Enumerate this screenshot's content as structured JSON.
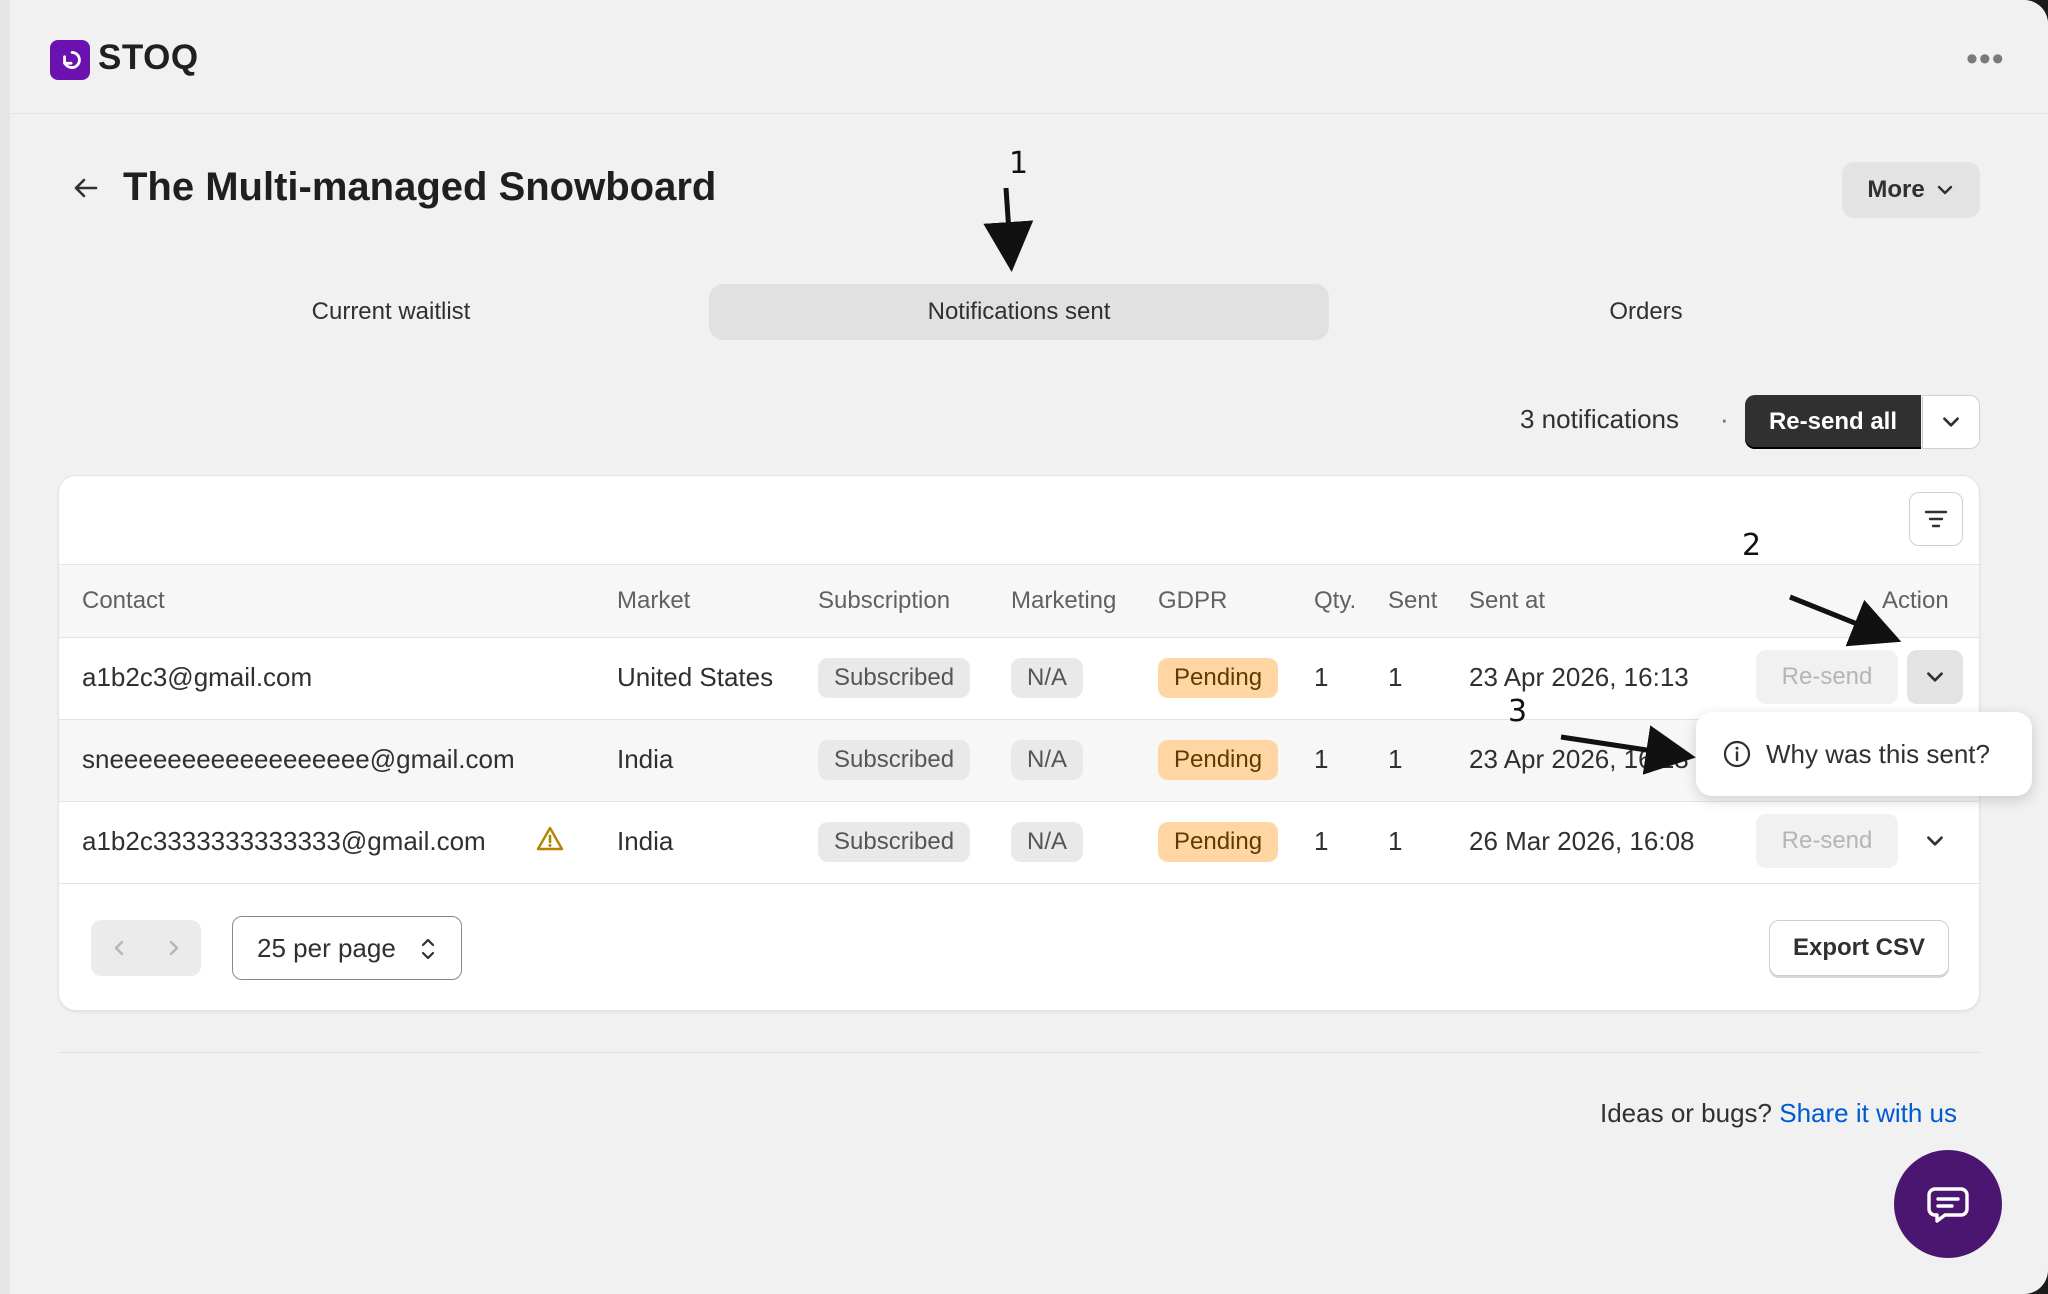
{
  "app": {
    "name": "STOQ",
    "menu_icon": "more-horizontal-icon"
  },
  "header": {
    "title": "The Multi-managed Snowboard",
    "more_label": "More"
  },
  "tabs": [
    {
      "label": "Current waitlist",
      "selected": false
    },
    {
      "label": "Notifications sent",
      "selected": true
    },
    {
      "label": "Orders",
      "selected": false
    }
  ],
  "summary": {
    "count_text": "3 notifications",
    "separator": "·",
    "resend_all_label": "Re-send all"
  },
  "table": {
    "columns": [
      "Contact",
      "Market",
      "Subscription",
      "Marketing",
      "GDPR",
      "Qty.",
      "Sent",
      "Sent at",
      "Action"
    ],
    "rows": [
      {
        "contact": "a1b2c3@gmail.com",
        "market": "United States",
        "subscription": "Subscribed",
        "marketing": "N/A",
        "gdpr": "Pending",
        "qty": "1",
        "sent": "1",
        "sent_at": "23 Apr 2026, 16:13",
        "action": "Re-send",
        "warning": false
      },
      {
        "contact": "sneeeeeeeeeeeeeeeeee@gmail.com",
        "market": "India",
        "subscription": "Subscribed",
        "marketing": "N/A",
        "gdpr": "Pending",
        "qty": "1",
        "sent": "1",
        "sent_at": "23 Apr 2026, 16:13",
        "action": "Re-send",
        "warning": false
      },
      {
        "contact": "a1b2c3333333333333@gmail.com",
        "market": "India",
        "subscription": "Subscribed",
        "marketing": "N/A",
        "gdpr": "Pending",
        "qty": "1",
        "sent": "1",
        "sent_at": "26 Mar 2026, 16:08",
        "action": "Re-send",
        "warning": true
      }
    ]
  },
  "pagination": {
    "per_page_label": "25 per page",
    "export_label": "Export CSV"
  },
  "popover": {
    "label": "Why was this sent?",
    "icon": "info-icon"
  },
  "footer": {
    "prefix": "Ideas or bugs?",
    "link_text": "Share it with us"
  },
  "annotations": [
    "1",
    "2",
    "3"
  ],
  "colors": {
    "brand": "#6a11b0",
    "chat": "#4a1670",
    "pending_badge": "#ffd6a3",
    "link": "#005bd3",
    "primary_button": "#303030"
  }
}
